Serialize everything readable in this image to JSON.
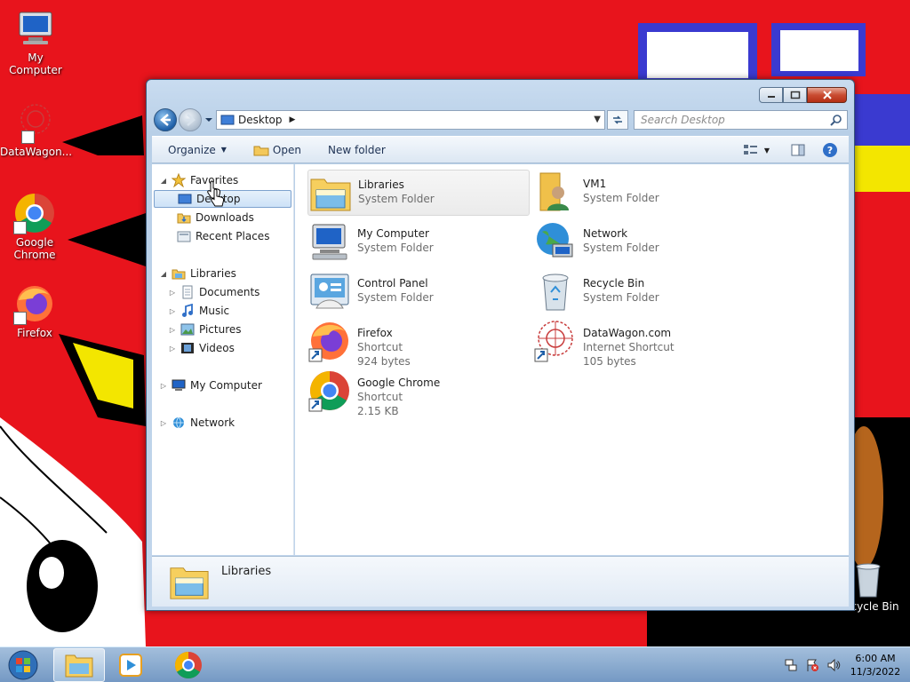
{
  "desktop": {
    "icons": [
      {
        "label": "My Computer"
      },
      {
        "label": "DataWagon..."
      },
      {
        "label": "Google Chrome"
      },
      {
        "label": "Firefox"
      },
      {
        "label": "Recycle Bin"
      }
    ]
  },
  "window": {
    "address": {
      "path": "Desktop"
    },
    "search": {
      "placeholder": "Search Desktop"
    },
    "toolbar": {
      "organize": "Organize",
      "open": "Open",
      "new_folder": "New folder"
    },
    "navpane": {
      "favorites": "Favorites",
      "desktop": "Desktop",
      "downloads": "Downloads",
      "recent_places": "Recent Places",
      "libraries": "Libraries",
      "documents": "Documents",
      "music": "Music",
      "pictures": "Pictures",
      "videos": "Videos",
      "my_computer": "My Computer",
      "network": "Network"
    },
    "items": [
      {
        "name": "Libraries",
        "type": "System Folder",
        "size": ""
      },
      {
        "name": "VM1",
        "type": "System Folder",
        "size": ""
      },
      {
        "name": "My Computer",
        "type": "System Folder",
        "size": ""
      },
      {
        "name": "Network",
        "type": "System Folder",
        "size": ""
      },
      {
        "name": "Control Panel",
        "type": "System Folder",
        "size": ""
      },
      {
        "name": "Recycle Bin",
        "type": "System Folder",
        "size": ""
      },
      {
        "name": "Firefox",
        "type": "Shortcut",
        "size": "924 bytes"
      },
      {
        "name": "DataWagon.com",
        "type": "Internet Shortcut",
        "size": "105 bytes"
      },
      {
        "name": "Google Chrome",
        "type": "Shortcut",
        "size": "2.15 KB"
      }
    ],
    "details": {
      "name": "Libraries"
    }
  },
  "taskbar": {
    "clock": {
      "time": "6:00 AM",
      "date": "11/3/2022"
    }
  },
  "colors": {
    "wallpaper_red": "#e8141c",
    "window_frame": "#b8cfe7",
    "selection": "#cde2f7",
    "taskbar": "#8bb5da"
  }
}
